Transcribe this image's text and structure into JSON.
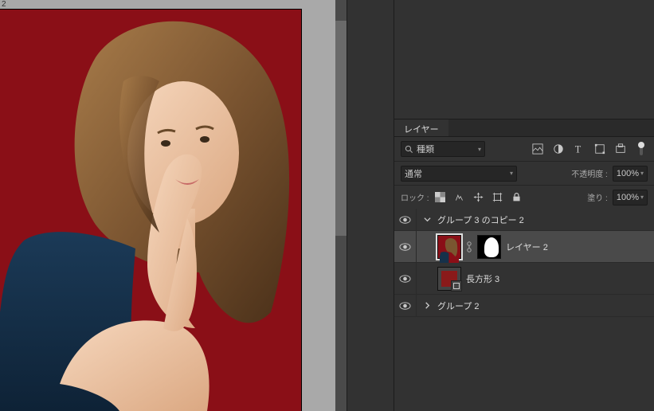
{
  "doc_tab": "2",
  "panel_title": "レイヤー",
  "filter": {
    "kind": "種類"
  },
  "blend": {
    "mode": "通常",
    "opacity_label": "不透明度 :",
    "opacity_value": "100%",
    "fill_label": "塗り :",
    "fill_value": "100%",
    "lock_label": "ロック :"
  },
  "layers": [
    {
      "kind": "group",
      "name": "グループ 3 のコピー 2",
      "open": true
    },
    {
      "kind": "image",
      "name": "レイヤー 2",
      "selected": true,
      "has_mask": true
    },
    {
      "kind": "shape",
      "name": "長方形 3"
    },
    {
      "kind": "group",
      "name": "グループ 2",
      "open": false
    }
  ],
  "colors": {
    "canvas_bg": "#8a0f17"
  }
}
